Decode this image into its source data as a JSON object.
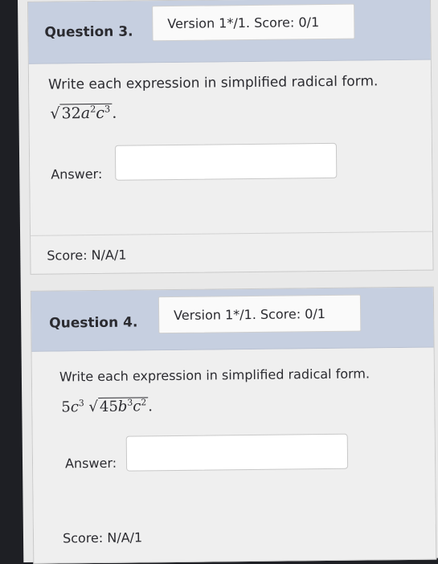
{
  "q3": {
    "title": "Question 3.",
    "version": "Version 1*/1. Score: 0/1",
    "prompt": "Write each expression in simplified radical form.",
    "radicand_coef": "32",
    "var_a": "a",
    "exp_a": "2",
    "var_c": "c",
    "exp_c": "3",
    "period": ".",
    "answer_label": "Answer:",
    "answer_value": "",
    "score": "Score: N/A/1"
  },
  "q4": {
    "title": "Question 4.",
    "version": "Version 1*/1. Score: 0/1",
    "prompt": "Write each expression in simplified radical form.",
    "outer_coef": "5",
    "outer_var": "c",
    "outer_exp": "3",
    "radicand_coef": "45",
    "var_b": "b",
    "exp_b": "3",
    "var_c": "c",
    "exp_c": "2",
    "period": ".",
    "answer_label": "Answer:",
    "answer_value": "",
    "score": "Score: N/A/1"
  }
}
